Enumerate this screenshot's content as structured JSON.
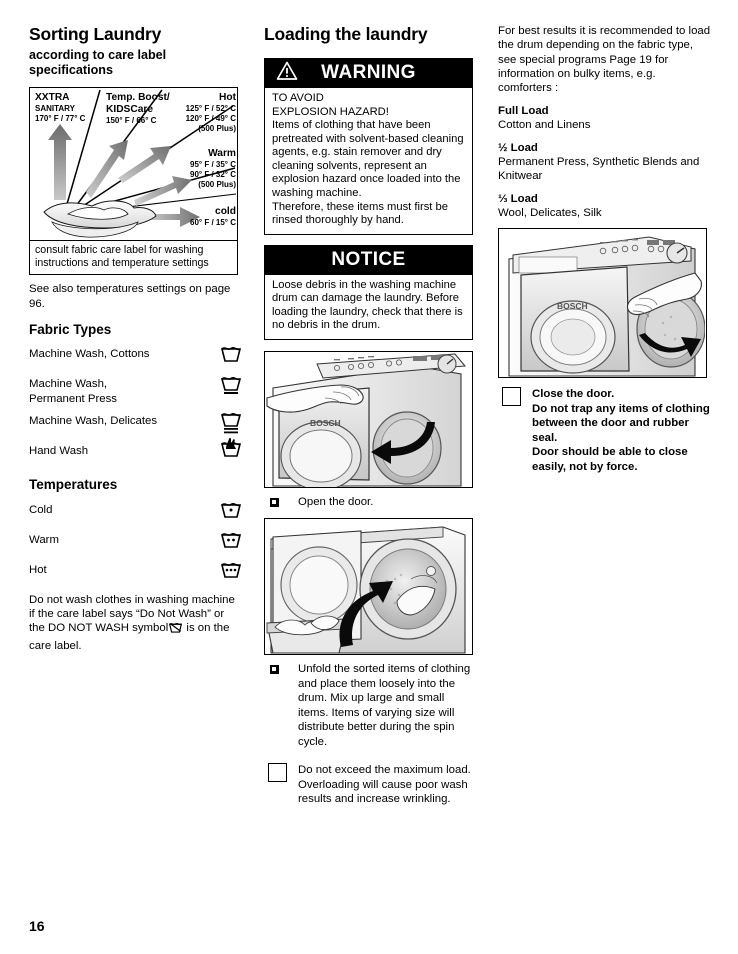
{
  "page": {
    "number": "16"
  },
  "left_column": {
    "title": "Sorting Laundry",
    "subtitle": "according to care label specifications",
    "diagram": {
      "labels": {
        "xxtra_name": "XXTRA",
        "xxtra_sub": "SANITARY",
        "xxtra_temp": "170° F / 77° C",
        "boost_name": "Temp. Boost/",
        "boost_name2": "KIDSCare",
        "boost_temp": "150° F / 66° C",
        "hot_name": "Hot",
        "hot_temp1": "125° F / 52° C",
        "hot_temp2": "120° F / 49° C",
        "hot_note": "(500 Plus)",
        "warm_name": "Warm",
        "warm_temp1": "95° F / 35° C",
        "warm_temp2": "90° F / 32° C",
        "warm_note": "(500 Plus)",
        "cold_name": "cold",
        "cold_temp": "60° F / 15° C"
      },
      "caption": "consult fabric care label for washing instructions and temperature settings"
    },
    "see_also": "See also temperatures settings on page 96.",
    "fabric_types_heading": "Fabric Types",
    "fabric_types": [
      {
        "label": "Machine Wash, Cottons",
        "icon": "wash-tub-icon"
      },
      {
        "label": "Machine Wash, Permanent Press",
        "icon": "wash-tub-one-bar-icon"
      },
      {
        "label": "Machine Wash, Delicates",
        "icon": "wash-tub-two-bar-icon"
      },
      {
        "label": "Hand Wash",
        "icon": "hand-wash-tub-icon"
      }
    ],
    "temperatures_heading": "Temperatures",
    "temperatures": [
      {
        "label": "Cold",
        "icon": "wash-tub-one-dot-icon"
      },
      {
        "label": "Warm",
        "icon": "wash-tub-two-dot-icon"
      },
      {
        "label": "Hot",
        "icon": "wash-tub-three-dot-icon"
      }
    ],
    "do_not_wash_note_1": "Do not wash clothes in washing machine if the care label says “Do Not Wash” or the DO NOT WASH symbol",
    "do_not_wash_note_2": " is on the care label."
  },
  "middle_column": {
    "title": "Loading the laundry",
    "warning": {
      "heading": "WARNING",
      "icon": "warning-triangle-icon",
      "body": "TO AVOID\nEXPLOSION HAZARD!\nItems of clothing that have been pretreated with solvent-based cleaning agents, e.g. stain remover and dry cleaning solvents, represent an explosion hazard once loaded into the washing machine.\nTherefore, these items must first be rinsed thoroughly by hand."
    },
    "notice": {
      "heading": "NOTICE",
      "body": "Loose debris in the washing machine drum can damage the laundry. Before loading the laundry, check that there is no debris in the drum."
    },
    "figure_open_door": {
      "name": "washing-machine-open-door-illustration",
      "brand": "BOSCH"
    },
    "step_open_door": "Open the door.",
    "figure_load_drum": {
      "name": "loading-laundry-into-drum-illustration"
    },
    "step_unfold": "Unfold the sorted items of clothing and place them loosely into the drum. Mix up large and small items. Items of varying size will distribute better during the spin cycle.",
    "step_max_load": "Do not exceed the maximum load. Overloading will cause poor wash results and increase wrinkling."
  },
  "right_column": {
    "intro": "For best results it is recommended to load the drum depending on the fabric type, see special programs Page 19 for information on bulky items, e.g. comforters :",
    "load_types": [
      {
        "heading": "Full Load",
        "body": "Cotton and Linens"
      },
      {
        "heading": "½ Load",
        "body": "Permanent Press, Synthetic Blends and Knitwear"
      },
      {
        "heading": "⅓ Load",
        "body": "Wool, Delicates, Silk"
      }
    ],
    "figure_close_door": {
      "name": "washing-machine-close-door-illustration",
      "brand": "BOSCH"
    },
    "step_close_door": "Close the door.\nDo not trap any items of clothing between the door and rubber seal.\nDoor should be able to close easily, not by force."
  }
}
